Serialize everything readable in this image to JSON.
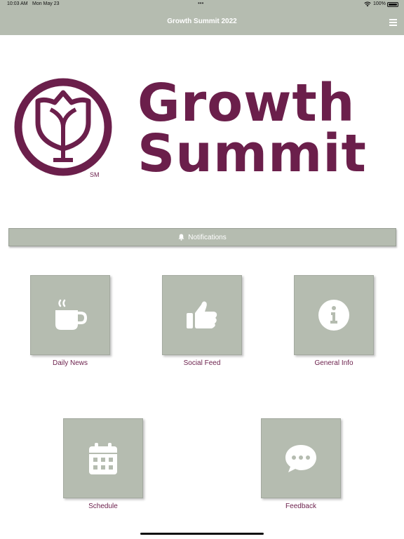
{
  "status_bar": {
    "time": "10:03 AM",
    "date": "Mon May 23",
    "dots": "•••",
    "battery_pct": "100%"
  },
  "nav": {
    "title": "Growth Summit 2022",
    "menu_icon": "hamburger-menu-icon"
  },
  "logo": {
    "line1": "Growth",
    "line2": "Summit",
    "sm": "SM",
    "color": "#6b1f4b"
  },
  "notifications": {
    "label": "Notifications",
    "icon": "bell-icon"
  },
  "tiles": [
    {
      "label": "Daily News",
      "icon": "coffee-cup-icon"
    },
    {
      "label": "Social Feed",
      "icon": "thumbs-up-icon"
    },
    {
      "label": "General Info",
      "icon": "info-icon"
    },
    {
      "label": "Schedule",
      "icon": "calendar-icon"
    },
    {
      "label": "Feedback",
      "icon": "chat-bubble-icon"
    }
  ],
  "colors": {
    "bar": "#b5bcb0",
    "brand": "#6b1f4b",
    "icon": "#ffffff"
  }
}
